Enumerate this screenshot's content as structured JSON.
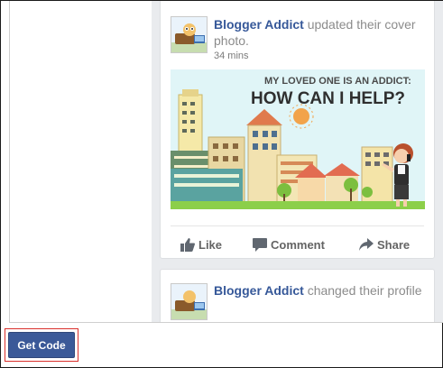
{
  "feed": {
    "posts": [
      {
        "author": "Blogger Addict",
        "action": " updated their cover photo.",
        "time": "34 mins",
        "image": {
          "headline_top": "MY LOVED ONE IS AN ADDICT:",
          "headline_main": "HOW CAN I HELP?"
        },
        "actions": {
          "like": "Like",
          "comment": "Comment",
          "share": "Share"
        }
      },
      {
        "author": "Blogger Addict",
        "action": " changed their profile"
      }
    ]
  },
  "footer": {
    "get_code_label": "Get Code"
  },
  "colors": {
    "facebook_blue": "#3b5998",
    "author_link": "#365899",
    "highlight_border": "#d9302c"
  }
}
